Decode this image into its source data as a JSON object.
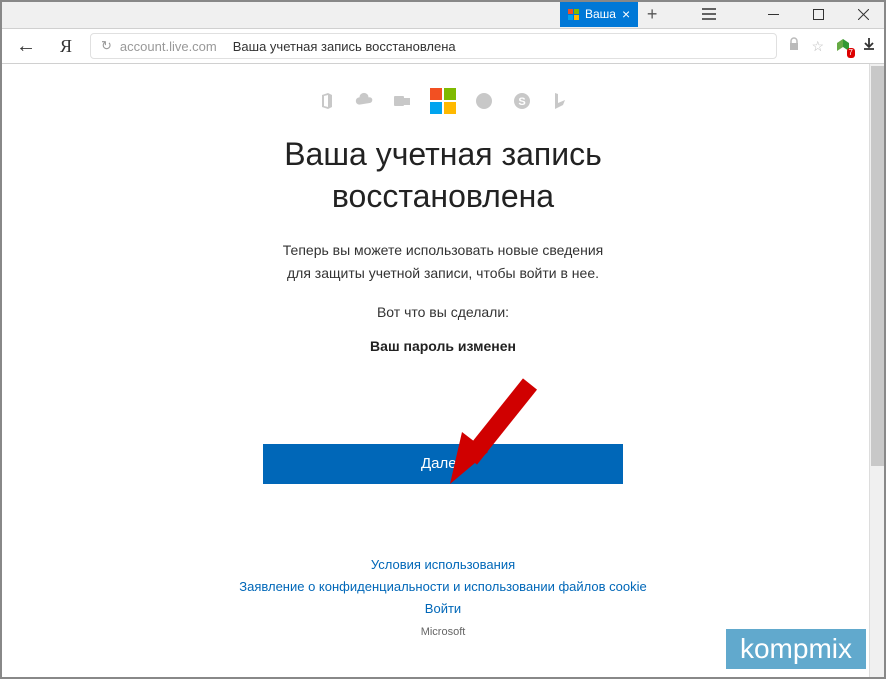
{
  "window": {
    "tab_title": "Ваша",
    "new_tab_tooltip": "Новая вкладка"
  },
  "addressbar": {
    "host": "account.live.com",
    "page_title": "Ваша учетная запись восстановлена",
    "extension_badge": "7"
  },
  "service_icons": [
    "office-icon",
    "onedrive-icon",
    "outlook-icon",
    "microsoft-logo",
    "xbox-icon",
    "skype-icon",
    "bing-icon"
  ],
  "page": {
    "heading_line1": "Ваша учетная запись",
    "heading_line2": "восстановлена",
    "subtext_line1": "Теперь вы можете использовать новые сведения",
    "subtext_line2": "для защиты учетной записи, чтобы войти в нее.",
    "what_you_did": "Вот что вы сделали:",
    "password_changed": "Ваш пароль изменен",
    "next_button": "Далее"
  },
  "footer": {
    "terms": "Условия использования",
    "privacy": "Заявление о конфиденциальности и использовании файлов cookie",
    "signin": "Войти",
    "brand": "Microsoft"
  },
  "watermark": "kompmix"
}
